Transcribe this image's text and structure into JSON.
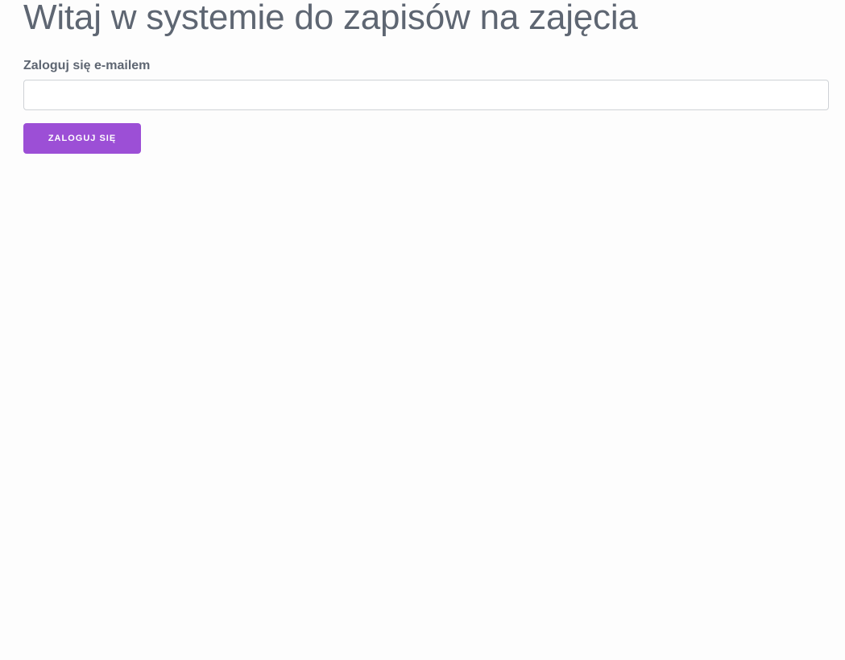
{
  "main": {
    "title": "Witaj w systemie do zapisów na zajęcia",
    "email_label": "Zaloguj się e-mailem",
    "email_value": "",
    "email_placeholder": "",
    "login_button_label": "ZALOGUJ SIĘ"
  },
  "colors": {
    "text": "#5e6672",
    "accent": "#9c4fd6",
    "background": "#fdfdfd",
    "input_border": "#cfd2d6"
  }
}
